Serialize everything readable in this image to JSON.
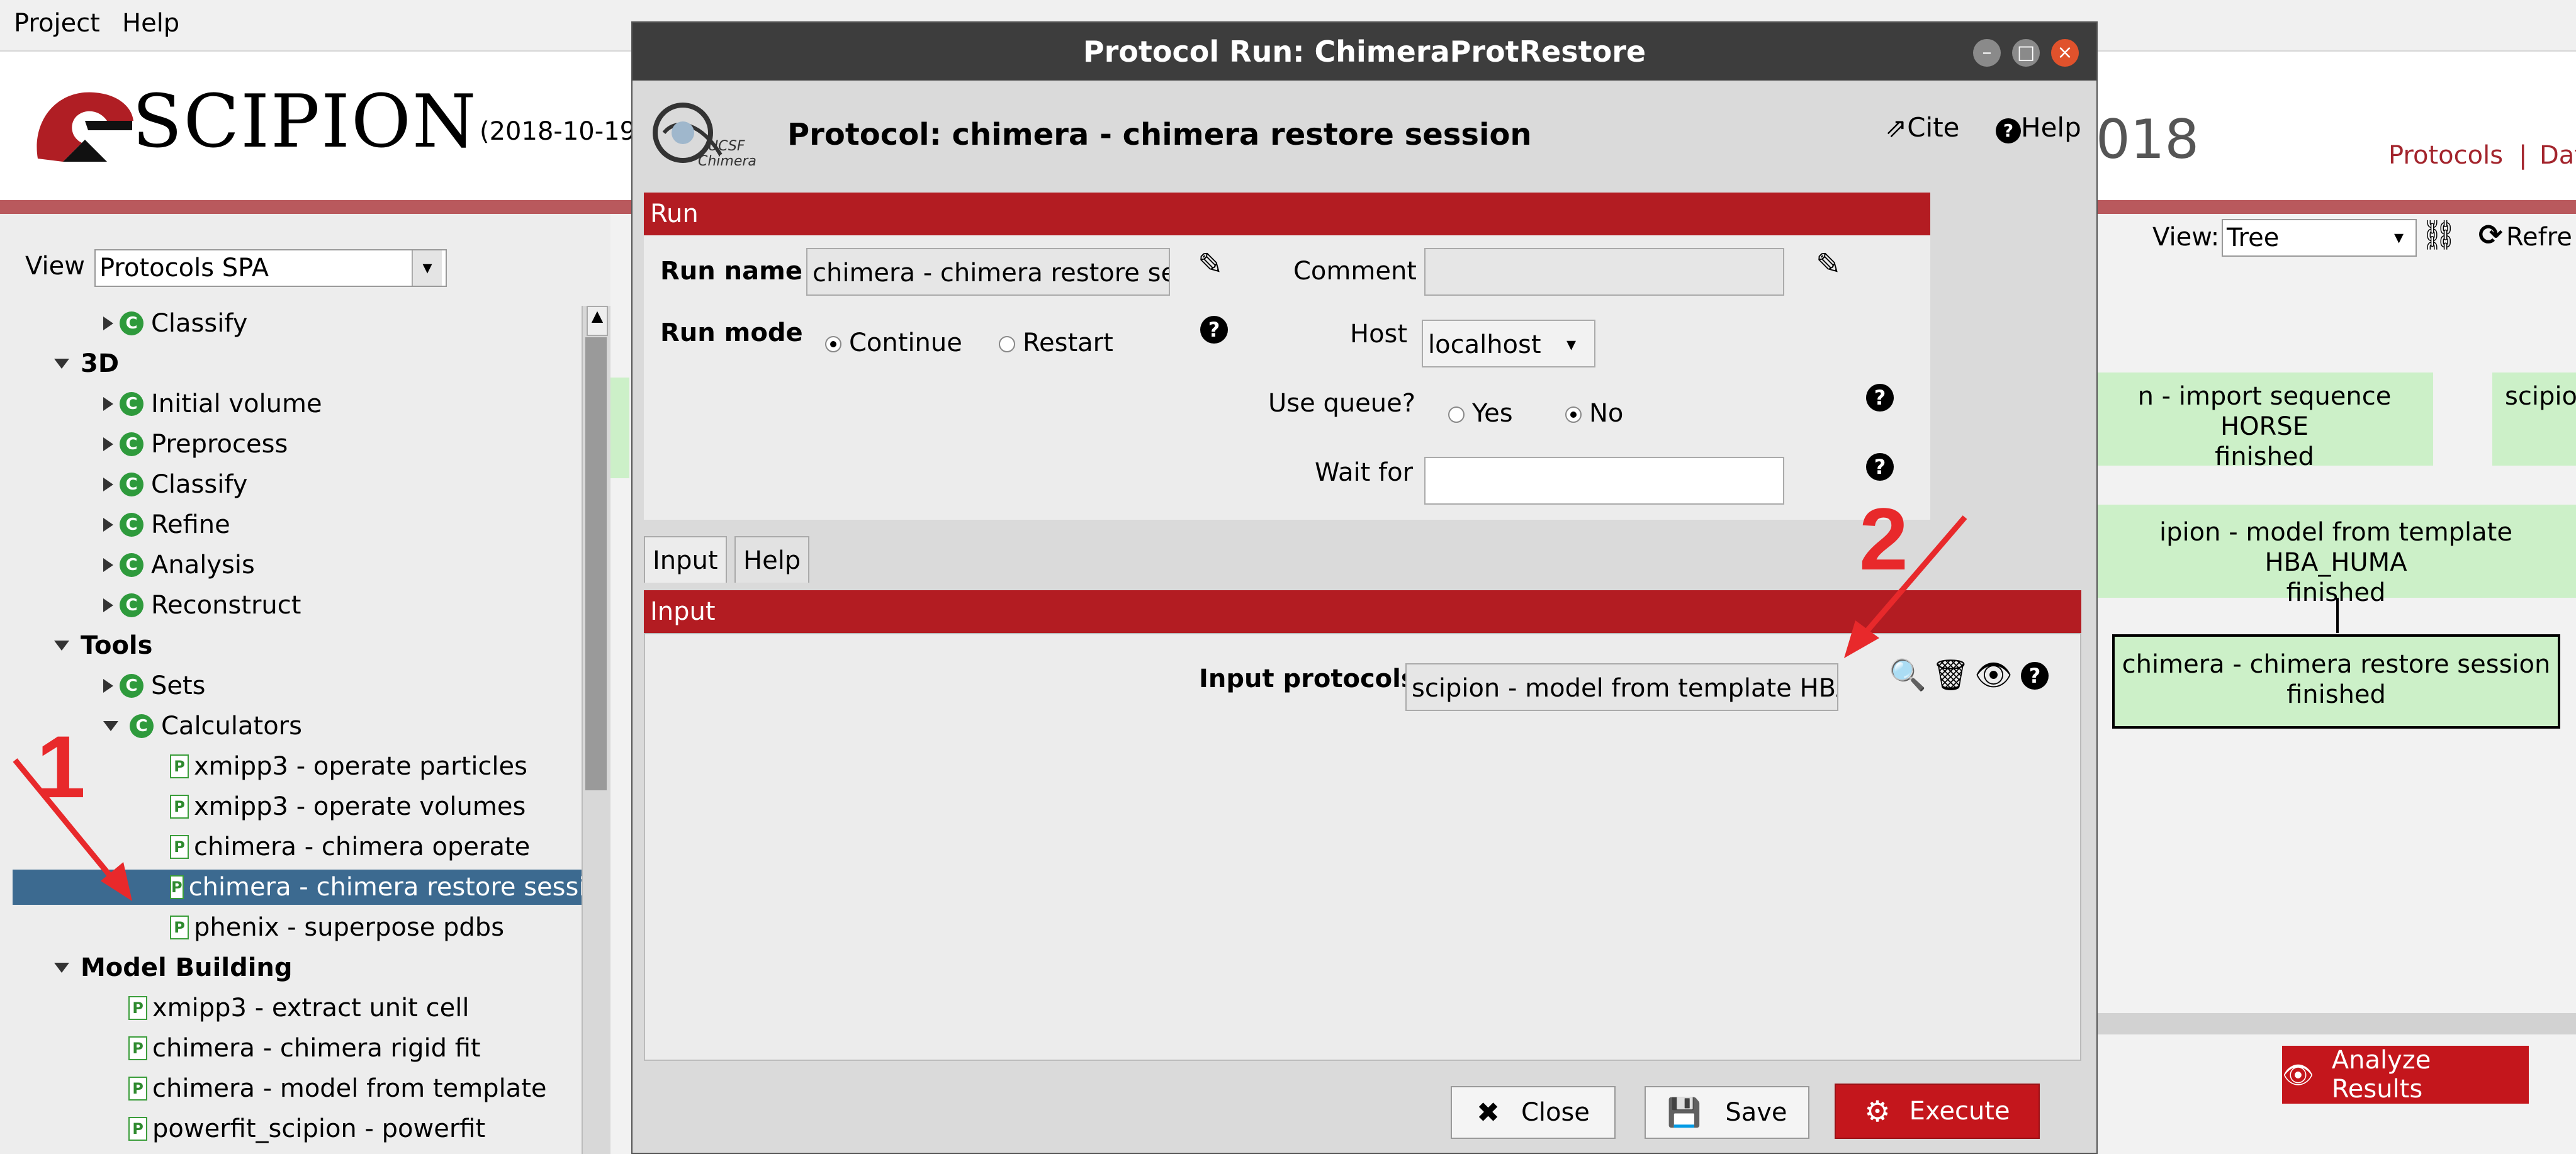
{
  "menubar": {
    "items": [
      "Project",
      "Help"
    ]
  },
  "header": {
    "logo": "SCIPION",
    "date_fragment": "(2018-10-19",
    "year_fragment": "018",
    "links": [
      "Protocols",
      "|",
      "Dat"
    ]
  },
  "left_panel": {
    "view_label": "View",
    "view_value": "Protocols SPA",
    "tree": [
      {
        "label": "Classify",
        "kind": "group",
        "depth": 1
      },
      {
        "label": "3D",
        "kind": "section"
      },
      {
        "label": "Initial volume",
        "kind": "group",
        "depth": 1
      },
      {
        "label": "Preprocess",
        "kind": "group",
        "depth": 1
      },
      {
        "label": "Classify",
        "kind": "group",
        "depth": 1
      },
      {
        "label": "Refine",
        "kind": "group",
        "depth": 1
      },
      {
        "label": "Analysis",
        "kind": "group",
        "depth": 1
      },
      {
        "label": "Reconstruct",
        "kind": "group",
        "depth": 1
      },
      {
        "label": "Tools",
        "kind": "section"
      },
      {
        "label": "Sets",
        "kind": "group",
        "depth": 1
      },
      {
        "label": "Calculators",
        "kind": "group-open",
        "depth": 1
      },
      {
        "label": "xmipp3 - operate particles",
        "kind": "protocol",
        "depth": 2
      },
      {
        "label": "xmipp3 - operate volumes",
        "kind": "protocol",
        "depth": 2
      },
      {
        "label": "chimera - chimera operate",
        "kind": "protocol",
        "depth": 2
      },
      {
        "label": "chimera - chimera restore sessi",
        "kind": "protocol",
        "depth": 2,
        "selected": true
      },
      {
        "label": "phenix - superpose pdbs",
        "kind": "protocol",
        "depth": 2
      },
      {
        "label": "Model Building",
        "kind": "section"
      },
      {
        "label": "xmipp3 - extract unit cell",
        "kind": "protocol",
        "depth": 1
      },
      {
        "label": "chimera - chimera rigid fit",
        "kind": "protocol",
        "depth": 1
      },
      {
        "label": "chimera - model from template",
        "kind": "protocol",
        "depth": 1
      },
      {
        "label": "powerfit_scipion - powerfit",
        "kind": "protocol",
        "depth": 1
      }
    ]
  },
  "right_panel": {
    "view_label": "View:",
    "view_value": "Tree",
    "refresh_label": "Refre",
    "boxes": [
      {
        "line1": "n - import sequence HORSE",
        "line2": "finished"
      },
      {
        "line1": "scipio",
        "line2": ""
      },
      {
        "line1": "ipion - model from template HBA_HUMA",
        "line2": "finished"
      },
      {
        "line1": "chimera - chimera restore session",
        "line2": "finished"
      }
    ],
    "analyze_label": "Analyze Results"
  },
  "dialog": {
    "title": "Protocol Run: ChimeraProtRestore",
    "protocol_heading": "Protocol: chimera - chimera restore session",
    "chimera_logo_text": [
      "UCSF",
      "Chimera"
    ],
    "cite_label": "Cite",
    "help_label": "Help",
    "run_section": "Run",
    "run_name_label": "Run name",
    "run_name_value": "chimera - chimera restore sess",
    "comment_label": "Comment",
    "comment_value": "",
    "run_mode_label": "Run mode",
    "run_mode_options": [
      "Continue",
      "Restart"
    ],
    "run_mode_selected": "Continue",
    "host_label": "Host",
    "host_value": "localhost",
    "use_queue_label": "Use queue?",
    "use_queue_options": [
      "Yes",
      "No"
    ],
    "use_queue_selected": "No",
    "wait_for_label": "Wait for",
    "wait_for_value": "",
    "tabs": [
      "Input",
      "Help"
    ],
    "input_section": "Input",
    "input_protocols_label": "Input protocols",
    "input_protocols_value": "scipion - model from template HBA_",
    "buttons": {
      "close": "Close",
      "save": "Save",
      "execute": "Execute"
    },
    "colors": {
      "section_red": "#b31c22",
      "execute_red": "#c4161c",
      "title_dark": "#3d3d3d"
    }
  },
  "annotations": {
    "one": "1",
    "two": "2",
    "arrow_color": "#e8292b"
  }
}
